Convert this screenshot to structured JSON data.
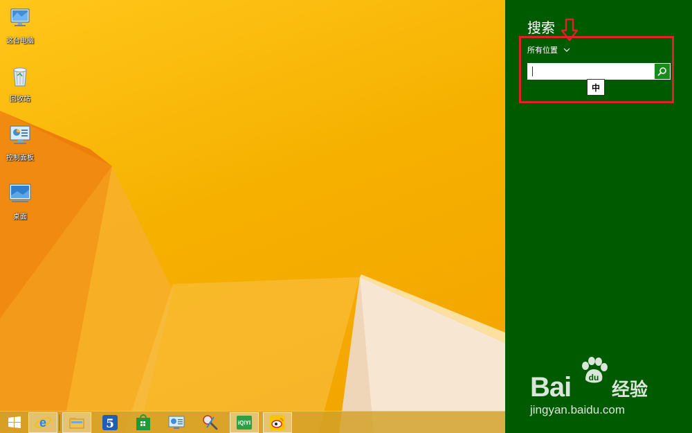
{
  "desktop": {
    "icons": [
      {
        "label": "这台电脑",
        "icon": "computer-icon"
      },
      {
        "label": "回收站",
        "icon": "recycle-bin-icon"
      },
      {
        "label": "控制面板",
        "icon": "control-panel-icon"
      },
      {
        "label": "桌面",
        "icon": "desktop-icon"
      }
    ]
  },
  "taskbar": {
    "items": [
      {
        "icon": "windows-start-icon"
      },
      {
        "icon": "internet-explorer-icon"
      },
      {
        "icon": "file-explorer-icon"
      },
      {
        "icon": "app-5-icon",
        "text": "5"
      },
      {
        "icon": "store-icon"
      },
      {
        "icon": "control-panel-icon"
      },
      {
        "icon": "tools-icon"
      },
      {
        "icon": "iqiyi-icon",
        "text": "iQIYI"
      },
      {
        "icon": "weibo-icon"
      }
    ]
  },
  "charm": {
    "title": "搜索",
    "scope_label": "所有位置",
    "search_value": "",
    "ime_indicator": "中",
    "background": "#005a00",
    "annotation_color": "#e0202a"
  },
  "watermark": {
    "brand": "Bai",
    "brand_cn": "经验",
    "url": "jingyan.baidu.com"
  }
}
